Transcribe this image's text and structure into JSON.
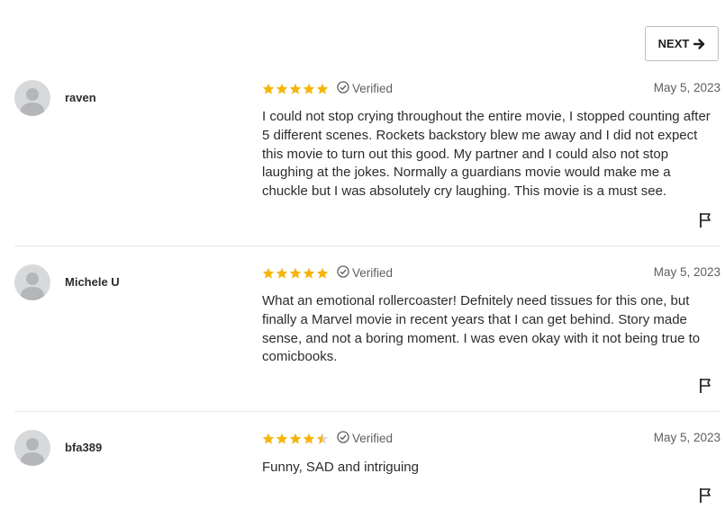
{
  "pagination": {
    "next_label": "NEXT"
  },
  "colors": {
    "star": "#f5b50a",
    "star_empty": "#d9d9d9",
    "text": "#2a2c2e",
    "muted": "#5c5f63"
  },
  "reviews": [
    {
      "user": "raven",
      "rating": 5,
      "verified_label": "Verified",
      "date": "May 5, 2023",
      "text": "I could not stop crying throughout the entire movie, I stopped counting after 5 different scenes. Rockets backstory blew me away and I did not expect this movie to turn out this good. My partner and I could also not stop laughing at the jokes. Normally a guardians movie would make me a chuckle but I was absolutely cry laughing. This movie is a must see."
    },
    {
      "user": "Michele U",
      "rating": 5,
      "verified_label": "Verified",
      "date": "May 5, 2023",
      "text": "What an emotional rollercoaster! Defnitely need tissues for this one, but finally a Marvel movie in recent years that I can get behind. Story made sense, and not a boring moment. I was even okay with it not being true to comicbooks."
    },
    {
      "user": "bfa389",
      "rating": 4.5,
      "verified_label": "Verified",
      "date": "May 5, 2023",
      "text": "Funny, SAD and intriguing"
    }
  ]
}
